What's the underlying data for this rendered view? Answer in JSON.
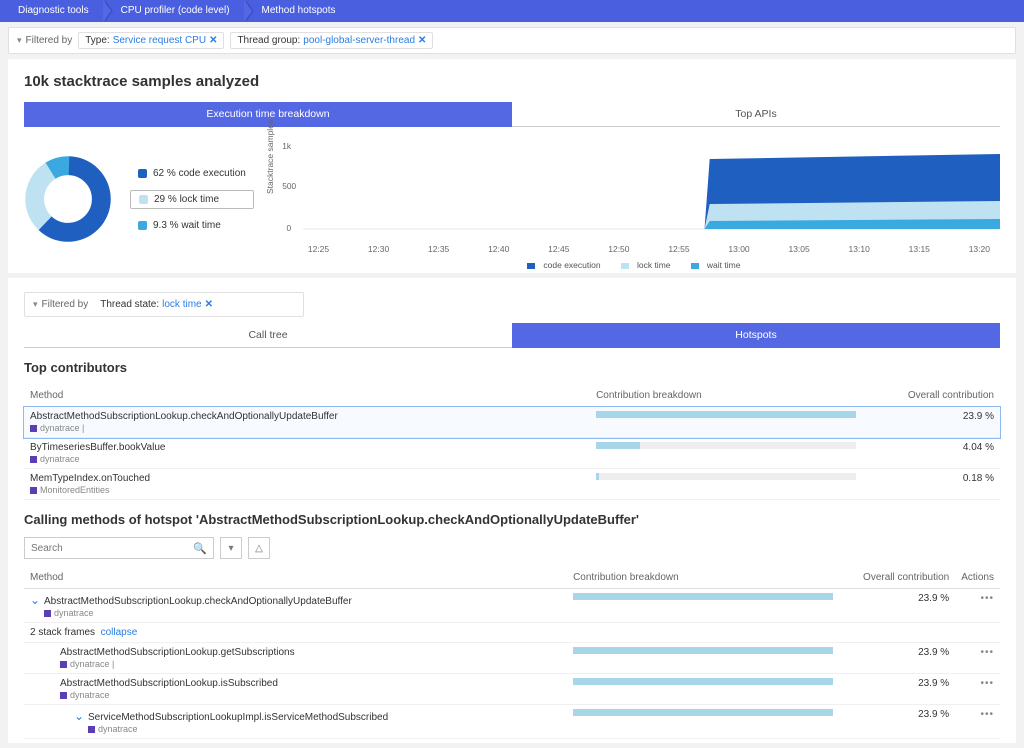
{
  "breadcrumb": [
    "Diagnostic tools",
    "CPU profiler (code level)",
    "Method hotspots"
  ],
  "filter1": {
    "label": "Filtered by",
    "chip1_key": "Type:",
    "chip1_val": "Service request CPU",
    "chip2_key": "Thread group:",
    "chip2_val": "pool-global-server-thread"
  },
  "title": "10k stacktrace samples analyzed",
  "tabs": {
    "t1": "Execution time breakdown",
    "t2": "Top APIs"
  },
  "donut_legend": {
    "l1": "62 % code execution",
    "l2": "29 % lock time",
    "l3": "9.3 % wait time"
  },
  "colors": {
    "code": "#1f5fbf",
    "lock": "#bfe2f2",
    "wait": "#3aa9e0"
  },
  "chart_data": {
    "type": "area",
    "ylabel": "Stacktrace samples",
    "ylim": [
      0,
      1000
    ],
    "yticks": [
      "0",
      "500",
      "1k"
    ],
    "xticks": [
      "12:25",
      "12:30",
      "12:35",
      "12:40",
      "12:45",
      "12:50",
      "12:55",
      "13:00",
      "13:05",
      "13:10",
      "13:15",
      "13:20"
    ],
    "series": [
      {
        "name": "code execution",
        "color": "#1f5fbf"
      },
      {
        "name": "lock time",
        "color": "#bfe2f2"
      },
      {
        "name": "wait time",
        "color": "#3aa9e0"
      }
    ],
    "note": "near-zero until ~12:57, then step to ~800-900 total samples; lock ≈ 250, wait ≈ 80, rest code"
  },
  "filter2": {
    "label": "Filtered by",
    "chip_key": "Thread state:",
    "chip_val": "lock time"
  },
  "subtabs": {
    "t1": "Call tree",
    "t2": "Hotspots"
  },
  "top_title": "Top contributors",
  "cols": {
    "c1": "Method",
    "c2": "Contribution breakdown",
    "c3": "Overall contribution",
    "c4": "Actions"
  },
  "rows": [
    {
      "m": "AbstractMethodSubscriptionLookup.checkAndOptionallyUpdateBuffer",
      "p": "dynatrace |",
      "pct": 23.9,
      "v": "23.9 %"
    },
    {
      "m": "ByTimeseriesBuffer.bookValue",
      "p": "dynatrace",
      "pct": 4.04,
      "v": "4.04 %"
    },
    {
      "m": "MemTypeIndex.onTouched",
      "p": "MonitoredEntities",
      "pct": 0.18,
      "v": "0.18 %"
    }
  ],
  "calling_title": "Calling methods of hotspot 'AbstractMethodSubscriptionLookup.checkAndOptionallyUpdateBuffer'",
  "search_placeholder": "Search",
  "callrows": {
    "r1": {
      "m": "AbstractMethodSubscriptionLookup.checkAndOptionallyUpdateBuffer",
      "p": "dynatrace",
      "v": "23.9 %"
    },
    "stack_label": "2 stack frames",
    "collapse": "collapse",
    "r2": {
      "m": "AbstractMethodSubscriptionLookup.getSubscriptions",
      "p": "dynatrace |",
      "v": "23.9 %"
    },
    "r3": {
      "m": "AbstractMethodSubscriptionLookup.isSubscribed",
      "p": "dynatrace",
      "v": "23.9 %"
    },
    "r4": {
      "m": "ServiceMethodSubscriptionLookupImpl.isServiceMethodSubscribed",
      "p": "dynatrace",
      "v": "23.9 %"
    }
  },
  "dots": "•••"
}
